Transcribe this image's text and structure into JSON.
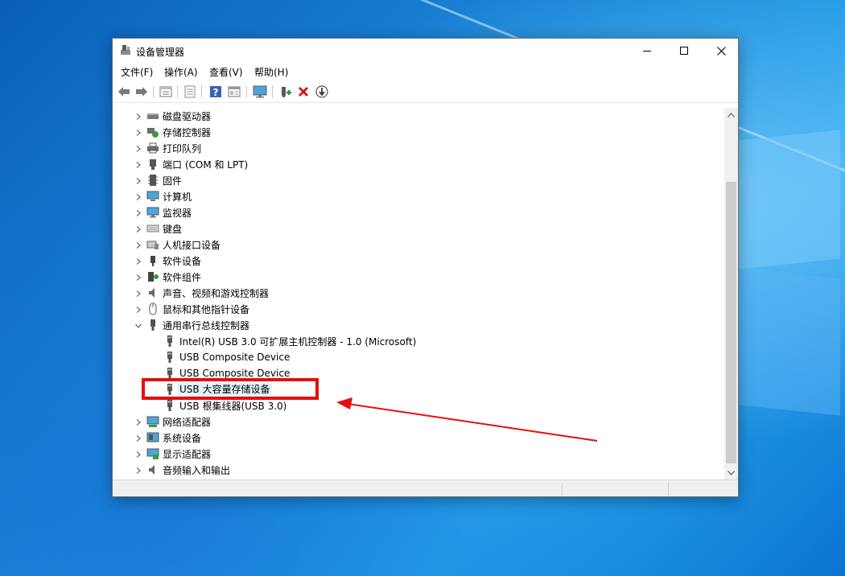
{
  "window": {
    "title": "设备管理器",
    "controls": {
      "minimize": "minimize",
      "maximize": "maximize",
      "close": "close"
    }
  },
  "menu": [
    "文件(F)",
    "操作(A)",
    "查看(V)",
    "帮助(H)"
  ],
  "toolbar": {
    "icons": [
      "back-icon",
      "forward-icon",
      "properties-view-icon",
      "properties-icon",
      "help-icon",
      "device-view-icon",
      "monitor-scan-icon",
      "update-driver-icon",
      "uninstall-icon",
      "disable-icon"
    ]
  },
  "tree": {
    "categories_before": [
      {
        "label": "磁盘驱动器",
        "icon": "disk-icon"
      },
      {
        "label": "存储控制器",
        "icon": "storage-controller-icon"
      },
      {
        "label": "打印队列",
        "icon": "printer-icon"
      },
      {
        "label": "端口 (COM 和 LPT)",
        "icon": "port-icon"
      },
      {
        "label": "固件",
        "icon": "firmware-icon"
      },
      {
        "label": "计算机",
        "icon": "computer-icon"
      },
      {
        "label": "监视器",
        "icon": "monitor-icon"
      },
      {
        "label": "键盘",
        "icon": "keyboard-icon"
      },
      {
        "label": "人机接口设备",
        "icon": "hid-icon"
      },
      {
        "label": "软件设备",
        "icon": "software-device-icon"
      },
      {
        "label": "软件组件",
        "icon": "software-component-icon"
      },
      {
        "label": "声音、视频和游戏控制器",
        "icon": "speaker-icon"
      },
      {
        "label": "鼠标和其他指针设备",
        "icon": "mouse-icon"
      }
    ],
    "expanded": {
      "label": "通用串行总线控制器",
      "icon": "usb-icon",
      "children": [
        {
          "label": "Intel(R) USB 3.0 可扩展主机控制器 - 1.0 (Microsoft)"
        },
        {
          "label": "USB Composite Device"
        },
        {
          "label": "USB Composite Device"
        },
        {
          "label": "USB 大容量存储设备",
          "selected": true
        },
        {
          "label": "USB 根集线器(USB 3.0)"
        }
      ]
    },
    "categories_after": [
      {
        "label": "网络适配器",
        "icon": "network-icon"
      },
      {
        "label": "系统设备",
        "icon": "system-icon"
      },
      {
        "label": "显示适配器",
        "icon": "display-adapter-icon"
      },
      {
        "label": "音频输入和输出",
        "icon": "audio-icon"
      }
    ]
  },
  "colors": {
    "annotation": "#e60e0e",
    "selection": "#e5f3ff"
  }
}
